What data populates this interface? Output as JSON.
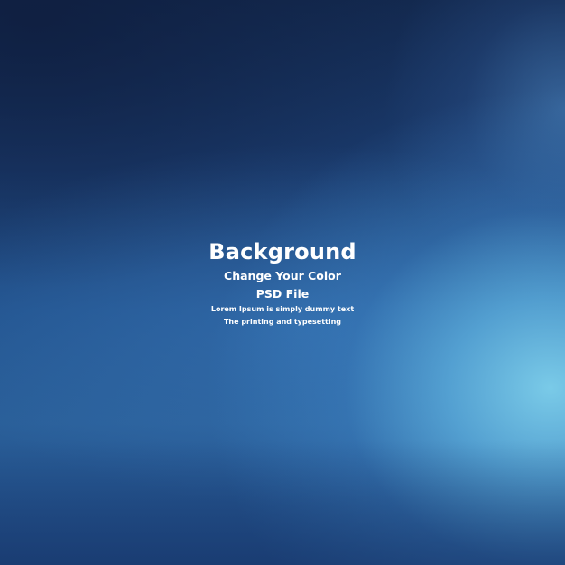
{
  "background": {
    "colors": {
      "dark_navy": "#13294f",
      "mid_blue": "#23548f",
      "light_blue_glow": "#7ed0ec"
    }
  },
  "text": {
    "title": "Background",
    "line1": "Change Your Color",
    "line2": "PSD File",
    "line3": "Lorem Ipsum is simply dummy text",
    "line4": "The printing and typesetting"
  }
}
